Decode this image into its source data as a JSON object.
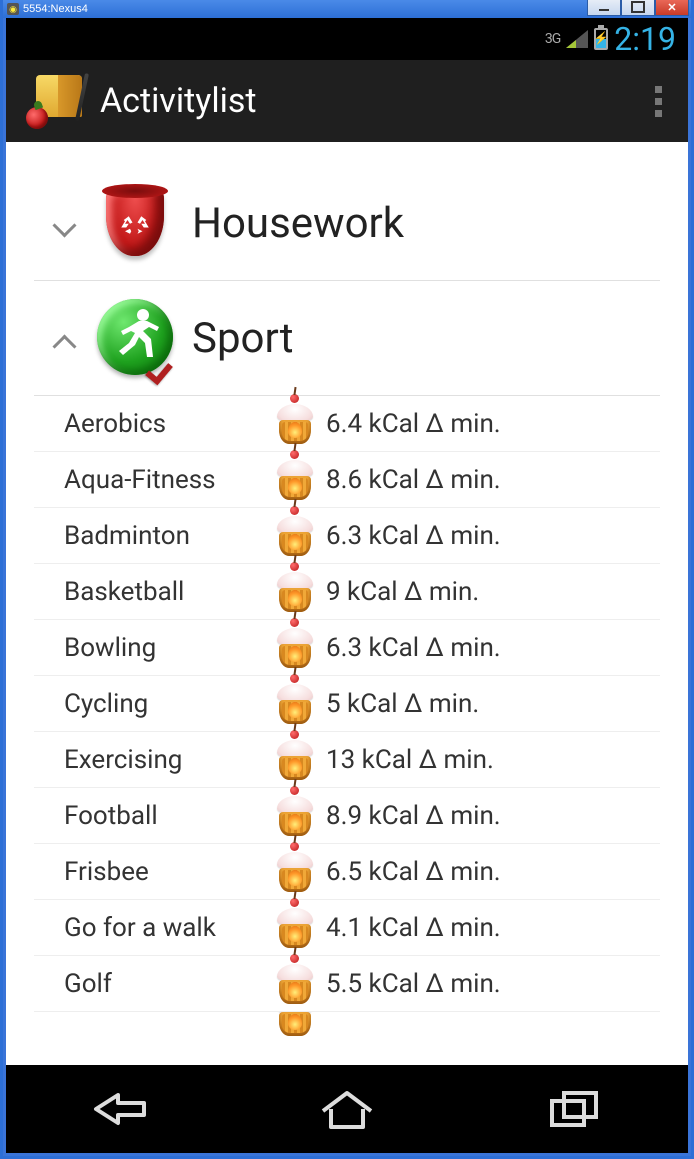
{
  "window": {
    "title": "5554:Nexus4"
  },
  "status": {
    "network": "3G",
    "time": "2:19"
  },
  "actionbar": {
    "title": "Activitylist"
  },
  "categories": {
    "housework": {
      "label": "Housework",
      "expanded": false
    },
    "sport": {
      "label": "Sport",
      "expanded": true
    }
  },
  "unit_template": "kCal Δ min.",
  "items": [
    {
      "name": "Aerobics",
      "kcal": "6.4"
    },
    {
      "name": "Aqua-Fitness",
      "kcal": "8.6"
    },
    {
      "name": "Badminton",
      "kcal": "6.3"
    },
    {
      "name": "Basketball",
      "kcal": "9"
    },
    {
      "name": "Bowling",
      "kcal": "6.3"
    },
    {
      "name": "Cycling",
      "kcal": "5"
    },
    {
      "name": "Exercising",
      "kcal": "13"
    },
    {
      "name": "Football",
      "kcal": "8.9"
    },
    {
      "name": "Frisbee",
      "kcal": "6.5"
    },
    {
      "name": "Go for a walk",
      "kcal": "4.1"
    },
    {
      "name": "Golf",
      "kcal": "5.5"
    }
  ]
}
